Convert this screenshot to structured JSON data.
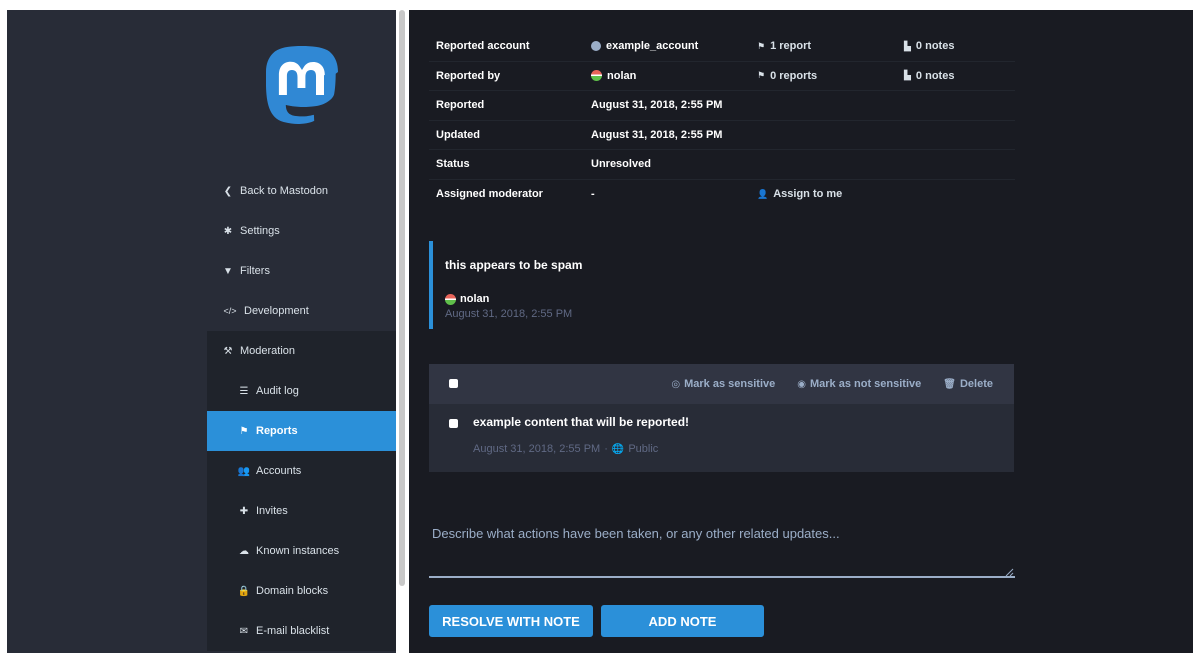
{
  "sidebar": {
    "items": [
      {
        "label": "Back to Mastodon",
        "icon": "chevron-left-icon"
      },
      {
        "label": "Settings",
        "icon": "gear-icon"
      },
      {
        "label": "Filters",
        "icon": "filter-icon"
      },
      {
        "label": "Development",
        "icon": "code-icon"
      },
      {
        "label": "Moderation",
        "icon": "gavel-icon"
      }
    ],
    "moderation_items": [
      {
        "label": "Audit log",
        "icon": "list-icon"
      },
      {
        "label": "Reports",
        "icon": "flag-icon",
        "active": true
      },
      {
        "label": "Accounts",
        "icon": "users-icon"
      },
      {
        "label": "Invites",
        "icon": "user-plus-icon"
      },
      {
        "label": "Known instances",
        "icon": "cloud-icon"
      },
      {
        "label": "Domain blocks",
        "icon": "lock-icon"
      },
      {
        "label": "E-mail blacklist",
        "icon": "envelope-icon"
      }
    ]
  },
  "report": {
    "rows": [
      {
        "label": "Reported account",
        "value": "example_account",
        "reports": "1 report",
        "notes": "0 notes"
      },
      {
        "label": "Reported by",
        "value": "nolan",
        "reports": "0 reports",
        "notes": "0 notes"
      },
      {
        "label": "Reported",
        "value": "August 31, 2018, 2:55 PM"
      },
      {
        "label": "Updated",
        "value": "August 31, 2018, 2:55 PM"
      },
      {
        "label": "Status",
        "value": "Unresolved"
      },
      {
        "label": "Assigned moderator",
        "value": "-",
        "action": "Assign to me"
      }
    ]
  },
  "comment": {
    "text": "this appears to be spam",
    "author": "nolan",
    "time": "August 31, 2018, 2:55 PM"
  },
  "statuses": {
    "actions": {
      "mark_sensitive": "Mark as sensitive",
      "mark_not_sensitive": "Mark as not sensitive",
      "delete": "Delete"
    },
    "items": [
      {
        "content": "example content that will be reported!",
        "time": "August 31, 2018, 2:55 PM",
        "separator": "·",
        "visibility": "Public"
      }
    ]
  },
  "note": {
    "placeholder": "Describe what actions have been taken, or any other related updates..."
  },
  "buttons": {
    "resolve": "RESOLVE WITH NOTE",
    "add_note": "ADD NOTE"
  },
  "colors": {
    "accent": "#2b90d9",
    "sidebar_bg": "#282c37",
    "content_bg": "#191b22",
    "muted": "#9baec8"
  }
}
